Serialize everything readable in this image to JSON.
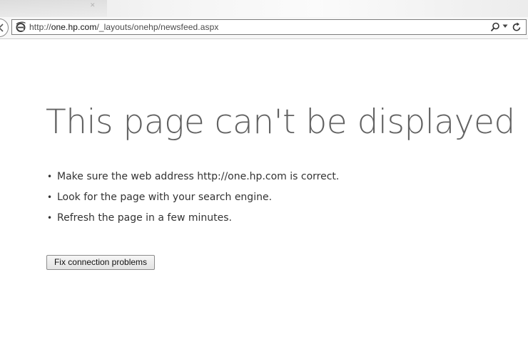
{
  "browser": {
    "address_bar": {
      "url_scheme": "http://",
      "url_host": "one.hp.com",
      "url_path": "/_layouts/onehp/newsfeed.aspx"
    },
    "icons": {
      "page": "ie-page-icon",
      "search": "search-icon",
      "dropdown": "chevron-down-icon",
      "refresh": "refresh-icon",
      "back": "back-arrow-icon"
    }
  },
  "error_page": {
    "title": "This page can't be displayed",
    "suggestions": [
      "Make sure the web address http://one.hp.com is correct.",
      "Look for the page with your search engine.",
      "Refresh the page in a few minutes."
    ],
    "bullet": "•",
    "fix_button_label": "Fix connection problems"
  },
  "colors": {
    "title": "#626262",
    "body_text": "#333333",
    "ie_icon": "#3a7bd5"
  }
}
